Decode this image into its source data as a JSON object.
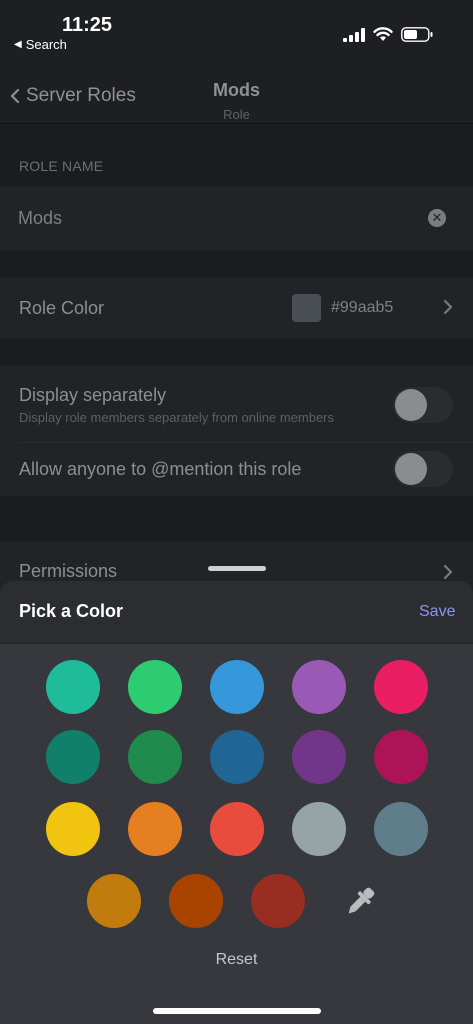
{
  "status": {
    "time": "11:25",
    "back_app": "Search"
  },
  "header": {
    "back_label": "Server Roles",
    "title": "Mods",
    "subtitle": "Role"
  },
  "role_name": {
    "section_label": "ROLE NAME",
    "value": "Mods"
  },
  "role_color": {
    "label": "Role Color",
    "hex": "#99aab5"
  },
  "display_separately": {
    "label": "Display separately",
    "description": "Display role members separately from online members",
    "enabled": false
  },
  "mention": {
    "label": "Allow anyone to @mention this role",
    "enabled": false
  },
  "permissions": {
    "label": "Permissions"
  },
  "picker": {
    "title": "Pick a Color",
    "save_label": "Save",
    "reset_label": "Reset",
    "colors": [
      [
        "#1fbc9c",
        "#2ecc71",
        "#3498db",
        "#9b59b6",
        "#e91e63"
      ],
      [
        "#11806a",
        "#1f8b4c",
        "#206694",
        "#71368a",
        "#ad1457"
      ],
      [
        "#f1c40f",
        "#e67e22",
        "#e74c3c",
        "#95a5a6",
        "#607d8b"
      ],
      [
        "#c27c0e",
        "#a84300",
        "#992d22"
      ]
    ],
    "eyedropper_icon": "eyedropper-icon"
  }
}
